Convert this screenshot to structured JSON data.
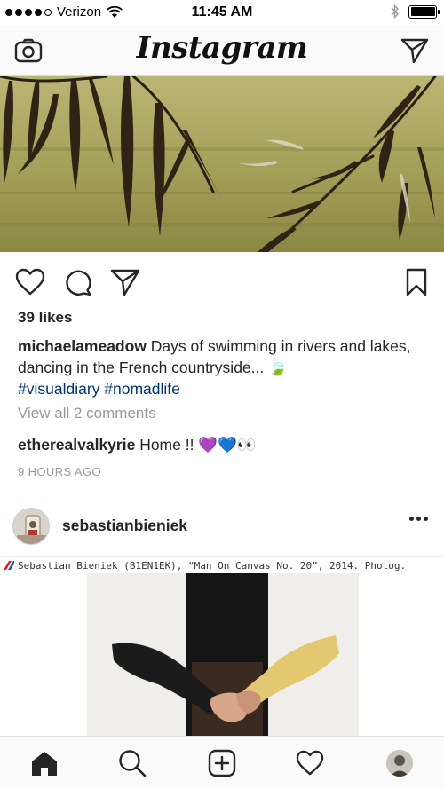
{
  "status_bar": {
    "carrier": "Verizon",
    "time": "11:45 AM",
    "signal_bars": 4,
    "signal_bars_total": 5,
    "battery_level": 1.0,
    "icons": [
      "wifi-icon",
      "bluetooth-icon",
      "battery-icon"
    ]
  },
  "nav": {
    "logo": "Instagram",
    "left_icon": "camera-icon",
    "right_icon": "direct-message-icon"
  },
  "post1": {
    "likes": "39 likes",
    "caption_user": "michaelameadow",
    "caption_text": " Days of swimming in rivers and lakes, dancing in the French countryside... 🍃",
    "hashtags": "#visualdiary #nomadlife",
    "view_comments": "View all 2 comments",
    "comment_user": "etherealvalkyrie",
    "comment_text": " Home !! 💜💙👀",
    "timestamp": "9 HOURS AGO",
    "actions": [
      "heart-icon",
      "comment-icon",
      "share-icon",
      "bookmark-icon"
    ]
  },
  "post2": {
    "username": "sebastianbieniek",
    "credit": "Sebastian Bieniek (B1EN1EK), “Man On Canvas No. 20”, 2014. Photog."
  },
  "tab_bar": {
    "items": [
      "home-icon",
      "search-icon",
      "new-post-icon",
      "activity-heart-icon",
      "profile-avatar"
    ],
    "active": "home-icon"
  }
}
